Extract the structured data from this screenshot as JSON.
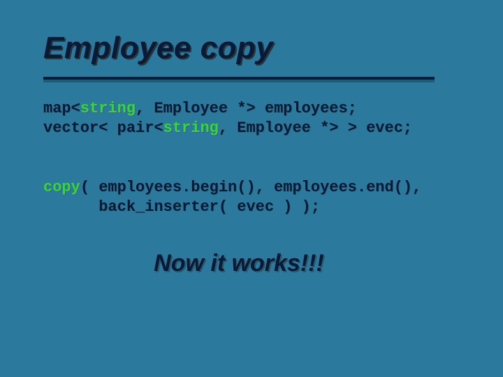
{
  "title": "Employee copy",
  "code1": {
    "l1a": "map<",
    "l1b": "string",
    "l1c": ", Employee *> employees;",
    "l2a": "vector< pair<",
    "l2b": "string",
    "l2c": ", Employee *> > evec;"
  },
  "code2": {
    "l1a": "copy",
    "l1b": "( employees.begin(), employees.end(),",
    "l2": "      back_inserter( evec ) );"
  },
  "conclusion": "Now it works!!!"
}
